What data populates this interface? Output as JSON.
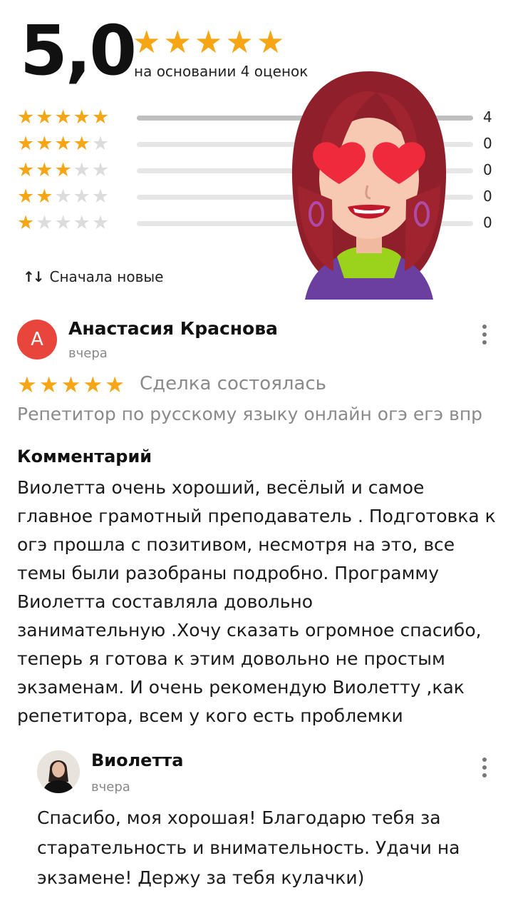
{
  "summary": {
    "rating": "5,0",
    "stars": 5,
    "based_on": "на основании 4 оценок"
  },
  "distribution": [
    {
      "stars": 5,
      "count": "4",
      "fraction": 1.0
    },
    {
      "stars": 4,
      "count": "0",
      "fraction": 0
    },
    {
      "stars": 3,
      "count": "0",
      "fraction": 0
    },
    {
      "stars": 2,
      "count": "0",
      "fraction": 0
    },
    {
      "stars": 1,
      "count": "0",
      "fraction": 0
    }
  ],
  "sort": {
    "label": "Сначала новые",
    "icon": "sort-arrows-icon"
  },
  "review": {
    "avatar_letter": "А",
    "avatar_color": "#e8463c",
    "author": "Анастасия Краснова",
    "date": "вчера",
    "stars": 5,
    "status": "Сделка состоялась",
    "service": "Репетитор по русскому языку онлайн огэ егэ впр",
    "comment_title": "Комментарий",
    "comment_lines": [
      "Виолетта очень хороший, весёлый и самое",
      "главное грамотный преподаватель . Подготовка к",
      "огэ прошла с  позитивом, несмотря на это, все",
      "темы были разобраны подробно. Программу",
      "Виолетта составляла довольно",
      "занимательную .Хочу сказать огромное спасибо,",
      "теперь я готова к этим довольно не простым",
      "экзаменам. И очень рекомендую Виолетту ,как",
      "репетитора, всем у кого есть проблемки"
    ]
  },
  "reply": {
    "author": "Виолетта",
    "date": "вчера",
    "lines": [
      "Спасибо, моя хорошая! Благодарю тебя за",
      "старательность и внимательность. Удачи на",
      "экзамене! Держу за тебя кулачки)"
    ]
  },
  "colors": {
    "star": "#f6a514",
    "star_off": "#dcdcdc",
    "bar": "#bfbfbf"
  }
}
